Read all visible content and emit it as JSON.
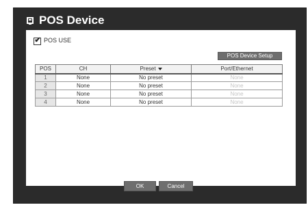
{
  "window": {
    "title": "POS Device"
  },
  "pos_use": {
    "label": "POS USE",
    "checked": true,
    "check_glyph": "✔"
  },
  "setup_button": {
    "label": "POS Device Setup"
  },
  "table": {
    "headers": [
      "POS",
      "CH",
      "Preset",
      "Port/Ethernet"
    ],
    "rows": [
      {
        "pos": "1",
        "ch": "None",
        "preset": "No preset",
        "port": "None"
      },
      {
        "pos": "2",
        "ch": "None",
        "preset": "No preset",
        "port": "None"
      },
      {
        "pos": "3",
        "ch": "None",
        "preset": "No preset",
        "port": "None"
      },
      {
        "pos": "4",
        "ch": "None",
        "preset": "No preset",
        "port": "None"
      }
    ]
  },
  "footer": {
    "ok_label": "OK",
    "cancel_label": "Cancel"
  },
  "colors": {
    "window_bg": "#2b2b2b",
    "panel_bg": "#ffffff",
    "button_bg": "#6e6e6e",
    "disabled_text": "#c4c4c4"
  },
  "icons": {
    "title_icon": "menu-icon",
    "sort_icon": "caret-down-icon"
  }
}
